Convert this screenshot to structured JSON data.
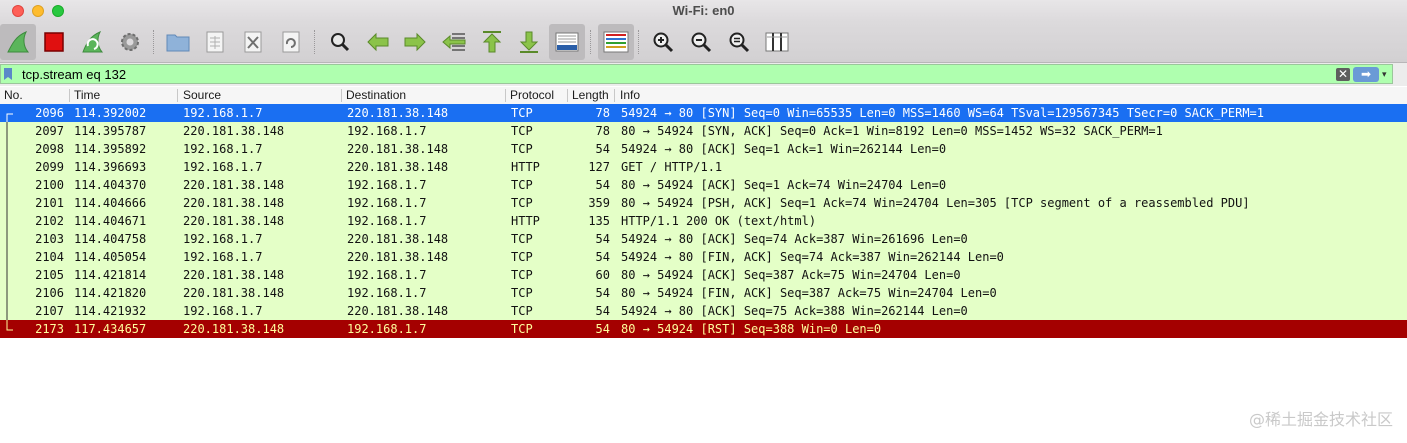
{
  "window": {
    "title": "Wi-Fi: en0"
  },
  "toolbar": {
    "buttons": [
      "start-capture",
      "stop-capture",
      "restart-capture",
      "capture-options",
      "open-file",
      "save-file",
      "close-file",
      "reload-file",
      "find-packet",
      "go-back",
      "go-forward",
      "go-to-packet",
      "go-first",
      "go-last",
      "auto-scroll",
      "colorize",
      "zoom-in",
      "zoom-out",
      "zoom-normal",
      "resize-columns"
    ]
  },
  "filter": {
    "value": "tcp.stream eq 132"
  },
  "columns": [
    "No.",
    "Time",
    "Source",
    "Destination",
    "Protocol",
    "Length",
    "Info"
  ],
  "packets": [
    {
      "no": "2096",
      "time": "114.392002",
      "src": "192.168.1.7",
      "dst": "220.181.38.148",
      "proto": "TCP",
      "len": "78",
      "info": "54924 → 80 [SYN] Seq=0 Win=65535 Len=0 MSS=1460 WS=64 TSval=129567345 TSecr=0 SACK_PERM=1"
    },
    {
      "no": "2097",
      "time": "114.395787",
      "src": "220.181.38.148",
      "dst": "192.168.1.7",
      "proto": "TCP",
      "len": "78",
      "info": "80 → 54924 [SYN, ACK] Seq=0 Ack=1 Win=8192 Len=0 MSS=1452 WS=32 SACK_PERM=1"
    },
    {
      "no": "2098",
      "time": "114.395892",
      "src": "192.168.1.7",
      "dst": "220.181.38.148",
      "proto": "TCP",
      "len": "54",
      "info": "54924 → 80 [ACK] Seq=1 Ack=1 Win=262144 Len=0"
    },
    {
      "no": "2099",
      "time": "114.396693",
      "src": "192.168.1.7",
      "dst": "220.181.38.148",
      "proto": "HTTP",
      "len": "127",
      "info": "GET / HTTP/1.1"
    },
    {
      "no": "2100",
      "time": "114.404370",
      "src": "220.181.38.148",
      "dst": "192.168.1.7",
      "proto": "TCP",
      "len": "54",
      "info": "80 → 54924 [ACK] Seq=1 Ack=74 Win=24704 Len=0"
    },
    {
      "no": "2101",
      "time": "114.404666",
      "src": "220.181.38.148",
      "dst": "192.168.1.7",
      "proto": "TCP",
      "len": "359",
      "info": "80 → 54924 [PSH, ACK] Seq=1 Ack=74 Win=24704 Len=305 [TCP segment of a reassembled PDU]"
    },
    {
      "no": "2102",
      "time": "114.404671",
      "src": "220.181.38.148",
      "dst": "192.168.1.7",
      "proto": "HTTP",
      "len": "135",
      "info": "HTTP/1.1 200 OK  (text/html)"
    },
    {
      "no": "2103",
      "time": "114.404758",
      "src": "192.168.1.7",
      "dst": "220.181.38.148",
      "proto": "TCP",
      "len": "54",
      "info": "54924 → 80 [ACK] Seq=74 Ack=387 Win=261696 Len=0"
    },
    {
      "no": "2104",
      "time": "114.405054",
      "src": "192.168.1.7",
      "dst": "220.181.38.148",
      "proto": "TCP",
      "len": "54",
      "info": "54924 → 80 [FIN, ACK] Seq=74 Ack=387 Win=262144 Len=0"
    },
    {
      "no": "2105",
      "time": "114.421814",
      "src": "220.181.38.148",
      "dst": "192.168.1.7",
      "proto": "TCP",
      "len": "60",
      "info": "80 → 54924 [ACK] Seq=387 Ack=75 Win=24704 Len=0"
    },
    {
      "no": "2106",
      "time": "114.421820",
      "src": "220.181.38.148",
      "dst": "192.168.1.7",
      "proto": "TCP",
      "len": "54",
      "info": "80 → 54924 [FIN, ACK] Seq=387 Ack=75 Win=24704 Len=0"
    },
    {
      "no": "2107",
      "time": "114.421932",
      "src": "192.168.1.7",
      "dst": "220.181.38.148",
      "proto": "TCP",
      "len": "54",
      "info": "54924 → 80 [ACK] Seq=75 Ack=388 Win=262144 Len=0"
    },
    {
      "no": "2173",
      "time": "117.434657",
      "src": "220.181.38.148",
      "dst": "192.168.1.7",
      "proto": "TCP",
      "len": "54",
      "info": "80 → 54924 [RST] Seq=388 Win=0 Len=0"
    }
  ],
  "row_styles": [
    "selected",
    "normal",
    "normal",
    "normal",
    "normal",
    "normal",
    "normal",
    "normal",
    "normal",
    "normal",
    "normal",
    "normal",
    "rst"
  ],
  "colors": {
    "selected": "#1a6ff2",
    "tcp_row": "#e4ffc7",
    "rst_row": "#a40000",
    "filter_valid": "#afffaf"
  },
  "watermark": "@稀土掘金技术社区"
}
